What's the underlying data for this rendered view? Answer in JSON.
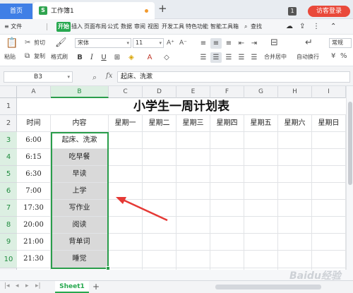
{
  "titlebar": {
    "home_tab": "首页",
    "doc_tab": "工作簿1",
    "doc_icon": "S",
    "new_tab": "+",
    "window_count": "1",
    "login_button": "访客登录"
  },
  "menubar": {
    "file": "≡ 文件",
    "items": [
      "开始",
      "插入",
      "页面布局",
      "公式",
      "数据",
      "审阅",
      "视图",
      "开发工具",
      "特色功能",
      "智能工具箱"
    ],
    "search": "查找"
  },
  "toolbar": {
    "paste": "粘贴",
    "cut": "剪切",
    "copy": "复制",
    "format_painter": "格式刷",
    "font_name": "宋体",
    "font_size": "11",
    "bold": "B",
    "italic": "I",
    "underline": "U",
    "merge_center": "合并居中",
    "auto_wrap": "自动换行",
    "number_format": "常规"
  },
  "formula_bar": {
    "cell_ref": "B3",
    "fx": "fx",
    "value": "起床、洗漱"
  },
  "columns": [
    "A",
    "B",
    "C",
    "D",
    "E",
    "F",
    "G",
    "H",
    "I"
  ],
  "rows": [
    "1",
    "2",
    "3",
    "4",
    "5",
    "6",
    "7",
    "8",
    "9",
    "10"
  ],
  "sheet": {
    "title": "小学生一周计划表",
    "header": [
      "时间",
      "内容",
      "星期一",
      "星期二",
      "星期三",
      "星期四",
      "星期五",
      "星期六",
      "星期日"
    ],
    "times": [
      "6:00",
      "6:15",
      "6:30",
      "7:00",
      "17:30",
      "20:00",
      "21:00",
      "21:30"
    ],
    "contents": [
      "起床、洗漱",
      "吃早餐",
      "早读",
      "上学",
      "写作业",
      "阅读",
      "背单词",
      "睡觉"
    ]
  },
  "sheet_tabs": {
    "active": "Sheet1",
    "add": "+"
  },
  "watermark": "Baidu经验"
}
